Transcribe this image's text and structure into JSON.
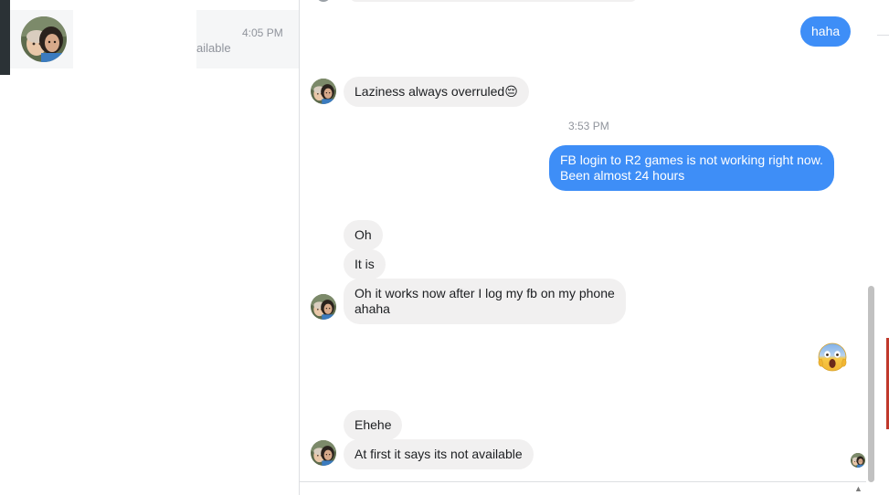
{
  "sidebar": {
    "conversation": {
      "time": "4:05 PM",
      "snippet": "ailable",
      "avatar_icon": "child-photo-avatar"
    }
  },
  "thread": {
    "messages": [
      {
        "id": "m1",
        "direction": "out",
        "text": "haha"
      },
      {
        "id": "m2",
        "direction": "in",
        "text": "Laziness always overruled😔"
      },
      {
        "id": "m3",
        "direction": "out",
        "lines": [
          "FB login to R2 games is not working right now.",
          "Been almost 24 hours"
        ]
      },
      {
        "id": "m4",
        "direction": "in",
        "text": "Oh"
      },
      {
        "id": "m5",
        "direction": "in",
        "text": "It is"
      },
      {
        "id": "m6",
        "direction": "in",
        "lines": [
          "Oh it works now after I log my fb on my phone",
          "ahaha"
        ]
      },
      {
        "id": "m7",
        "direction": "out",
        "emoji": "face-screaming-in-fear"
      },
      {
        "id": "m8",
        "direction": "in",
        "text": "Ehehe"
      },
      {
        "id": "m9",
        "direction": "in",
        "text": "At first it says its not available"
      }
    ],
    "timestamp": "3:53 PM"
  },
  "colors": {
    "outgoing_bubble": "#3e8ef7",
    "incoming_bubble": "#f1f0f0",
    "meta_text": "#90949c",
    "list_selected": "#f5f6f7"
  }
}
